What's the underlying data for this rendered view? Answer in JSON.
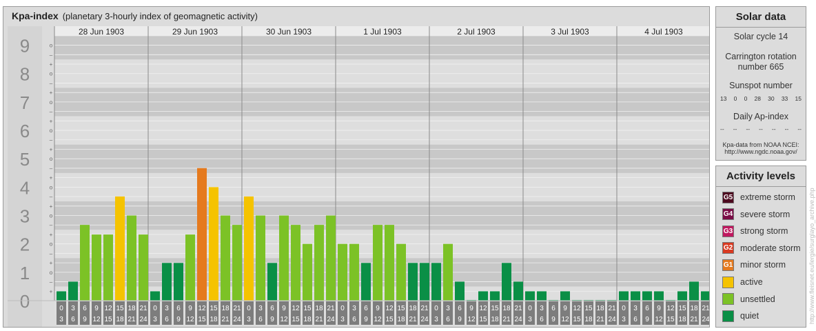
{
  "header": {
    "title": "Kpa-index",
    "subtitle": "(planetary 3-hourly index of geomagnetic activity)"
  },
  "chart_data": {
    "type": "bar",
    "kp_scale": [
      "0",
      "1",
      "2",
      "3",
      "4",
      "5",
      "6",
      "7",
      "8",
      "9"
    ],
    "sub_marks": [
      "+",
      "o",
      "–"
    ],
    "days": [
      "28 Jun 1903",
      "29 Jun 1903",
      "30 Jun 1903",
      "1 Jul 1903",
      "2 Jul 1903",
      "3 Jul 1903",
      "4 Jul 1903"
    ],
    "slot_top": [
      "0",
      "3",
      "6",
      "9",
      "12",
      "15",
      "18",
      "21"
    ],
    "slot_bottom": [
      "3",
      "6",
      "9",
      "12",
      "15",
      "18",
      "21",
      "24"
    ],
    "ylim": [
      0,
      9.33
    ],
    "values": [
      [
        0.33,
        0.67,
        2.67,
        2.33,
        2.33,
        3.67,
        3.0,
        2.33
      ],
      [
        0.33,
        1.33,
        1.33,
        2.33,
        4.67,
        4.0,
        3.0,
        2.67
      ],
      [
        3.67,
        3.0,
        1.33,
        3.0,
        2.67,
        2.0,
        2.67,
        3.0
      ],
      [
        2.0,
        2.0,
        1.33,
        2.67,
        2.67,
        2.0,
        1.33,
        1.33
      ],
      [
        1.33,
        2.0,
        0.67,
        0.0,
        0.33,
        0.33,
        1.33,
        0.67
      ],
      [
        0.33,
        0.33,
        0.0,
        0.33,
        0.0,
        0.0,
        0.0,
        0.0
      ],
      [
        0.33,
        0.33,
        0.33,
        0.33,
        0.0,
        0.33,
        0.67,
        0.33
      ]
    ],
    "levels": [
      {
        "code": "G5",
        "label": "extreme storm",
        "color": "#4d0a1f"
      },
      {
        "code": "G4",
        "label": "severe storm",
        "color": "#7a0c46"
      },
      {
        "code": "G3",
        "label": "strong storm",
        "color": "#c0185f"
      },
      {
        "code": "G2",
        "label": "moderate storm",
        "color": "#d93a22"
      },
      {
        "code": "G1",
        "label": "minor storm",
        "color": "#e57a1e"
      },
      {
        "code": "",
        "label": "active",
        "color": "#f5c300"
      },
      {
        "code": "",
        "label": "unsettled",
        "color": "#7cc226"
      },
      {
        "code": "",
        "label": "quiet",
        "color": "#0a8f46"
      }
    ]
  },
  "solar": {
    "title": "Solar data",
    "cycle": "Solar cycle 14",
    "carrington_line1": "Carrington rotation",
    "carrington_line2": "number 665",
    "sunspot_label": "Sunspot number",
    "sunspot_values": [
      "13",
      "0",
      "0",
      "28",
      "30",
      "33",
      "15"
    ],
    "ap_label": "Daily Ap-index",
    "ap_values": [
      "--",
      "--",
      "--",
      "--",
      "--",
      "--",
      "--"
    ],
    "source_line1": "Kpa-data from NOAA NCEI:",
    "source_line2": "http://www.ngdc.noaa.gov/"
  },
  "activity": {
    "title": "Activity levels"
  },
  "watermark": "http://www.fleisnet.eu/lergie/surglayo_archive.php"
}
